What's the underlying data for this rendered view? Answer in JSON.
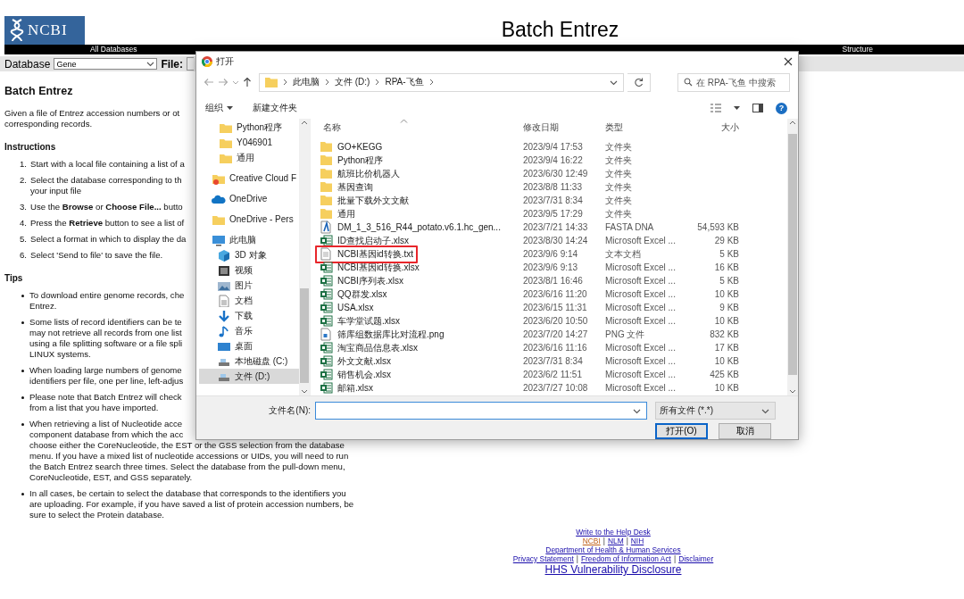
{
  "header": {
    "logo_text": "NCBI",
    "title": "Batch Entrez"
  },
  "nav_bar": [
    "All Databases",
    "Structure"
  ],
  "search_row": {
    "database_label": "Database",
    "database_value": "Gene",
    "file_label": "File:"
  },
  "content": {
    "heading": "Batch Entrez",
    "intro": [
      "Given a file of Entrez accession numbers or ot",
      "corresponding records."
    ],
    "sections": [
      {
        "heading": "Instructions",
        "kind": "numbered",
        "items": [
          {
            "number": "1.",
            "lines": [
              "Start with a local file containing a list of a"
            ]
          },
          {
            "number": "2.",
            "lines": [
              "Select the database corresponding to th",
              "your input file"
            ]
          },
          {
            "number": "3.",
            "lines": [
              "Use the **Browse** or **Choose File...** butto"
            ]
          },
          {
            "number": "4.",
            "lines": [
              "Press the **Retrieve** button to see a list of"
            ]
          },
          {
            "number": "5.",
            "lines": [
              "Select a format in which to display the da"
            ]
          },
          {
            "number": "6.",
            "lines": [
              "Select 'Send to file' to save the file."
            ]
          }
        ]
      },
      {
        "heading": "Tips",
        "kind": "bulleted",
        "items": [
          {
            "lines": [
              "To download entire genome records, che",
              "Entrez."
            ]
          },
          {
            "lines": [
              "Some lists of record identifiers can be te",
              "may not retrieve all records from one list",
              "using a file splitting software or a file spli",
              "LINUX systems."
            ]
          },
          {
            "lines": [
              "When loading large numbers of genome",
              "identifiers per file, one per line, left-adjus"
            ]
          },
          {
            "lines": [
              "Please note that Batch Entrez will check",
              "from a list that you have imported."
            ]
          },
          {
            "lines": [
              "When retrieving a list of Nucleotide acce",
              "component database from which the acc",
              "choose either the CoreNucleotide, the EST or the GSS selection from the database",
              "menu. If you have a mixed list of nucleotide accessions or UIDs, you will need to run",
              "the Batch Entrez search three times. Select the database from the pull-down menu,",
              "CoreNucleotide, EST, and GSS separately."
            ]
          },
          {
            "lines": [
              "In all cases, be certain to select the database that corresponds to the identifiers you",
              "are uploading. For example, if you have saved a list of protein accession numbers, be",
              "sure to select the Protein database."
            ]
          }
        ]
      }
    ]
  },
  "footer": [
    [
      {
        "kind": "link",
        "text": "Write to the Help Desk",
        "visited": false
      }
    ],
    [
      {
        "kind": "link",
        "text": "NCBI",
        "visited": true
      },
      {
        "kind": "separator",
        "text": "|"
      },
      {
        "kind": "link",
        "text": "NLM",
        "visited": false
      },
      {
        "kind": "separator",
        "text": "|"
      },
      {
        "kind": "link",
        "text": "NIH",
        "visited": false
      }
    ],
    [
      {
        "kind": "link",
        "text": "Department of Health & Human Services",
        "visited": false
      }
    ],
    [
      {
        "kind": "link",
        "text": "Privacy Statement",
        "visited": false
      },
      {
        "kind": "separator",
        "text": "|"
      },
      {
        "kind": "link",
        "text": "Freedom of Information Act",
        "visited": false
      },
      {
        "kind": "separator",
        "text": "|"
      },
      {
        "kind": "link",
        "text": "Disclaimer",
        "visited": false
      }
    ],
    [
      {
        "kind": "large-link",
        "text": "HHS Vulnerability Disclosure",
        "visited": false
      }
    ]
  ],
  "dialog": {
    "title": "打开",
    "path": [
      "此电脑",
      "文件 (D:)",
      "RPA-飞鱼"
    ],
    "search": {
      "placeholder": "在 RPA-飞鱼 中搜索"
    },
    "toolbar": [
      {
        "label": "组织",
        "kind": "menu"
      },
      {
        "label": "新建文件夹",
        "kind": "button"
      }
    ],
    "help_label": "?",
    "nav": {
      "scrolled_children": [
        {
          "label": "Python程序",
          "kind": "folder",
          "selected": false
        },
        {
          "label": "Y046901",
          "kind": "folder",
          "selected": false
        },
        {
          "label": "通用",
          "kind": "folder",
          "selected": false
        }
      ],
      "items": [
        {
          "label": "Creative Cloud F",
          "kind": "cloud-folder",
          "selected": false
        },
        {
          "label": "OneDrive",
          "kind": "cloud",
          "selected": false
        },
        {
          "label": "OneDrive - Pers",
          "kind": "folder",
          "selected": false
        },
        {
          "label": "此电脑",
          "kind": "computer",
          "selected": false,
          "children": [
            {
              "label": "3D 对象",
              "kind": "cube",
              "selected": false
            },
            {
              "label": "视频",
              "kind": "video",
              "selected": false
            },
            {
              "label": "图片",
              "kind": "image",
              "selected": false
            },
            {
              "label": "文档",
              "kind": "document",
              "selected": false
            },
            {
              "label": "下载",
              "kind": "download",
              "selected": false
            },
            {
              "label": "音乐",
              "kind": "music",
              "selected": false
            },
            {
              "label": "桌面",
              "kind": "desktop",
              "selected": false
            },
            {
              "label": "本地磁盘 (C:)",
              "kind": "drive",
              "selected": false
            },
            {
              "label": "文件 (D:)",
              "kind": "drive",
              "selected": true
            }
          ]
        }
      ]
    },
    "columns": [
      "名称",
      "修改日期",
      "类型",
      "大小"
    ],
    "rows": [
      {
        "name": "GO+KEGG",
        "date": "2023/9/4 17:53",
        "type": "文件夹",
        "kind": "folder",
        "highlighted": false
      },
      {
        "name": "Python程序",
        "date": "2023/9/4 16:22",
        "type": "文件夹",
        "kind": "folder",
        "highlighted": false
      },
      {
        "name": "航班比价机器人",
        "date": "2023/6/30 12:49",
        "type": "文件夹",
        "kind": "folder",
        "highlighted": false
      },
      {
        "name": "基因查询",
        "date": "2023/8/8 11:33",
        "type": "文件夹",
        "kind": "folder",
        "highlighted": false
      },
      {
        "name": "批量下载外文文献",
        "date": "2023/7/31 8:34",
        "type": "文件夹",
        "kind": "folder",
        "highlighted": false
      },
      {
        "name": "通用",
        "date": "2023/9/5 17:29",
        "type": "文件夹",
        "kind": "folder",
        "highlighted": false
      },
      {
        "name": "DM_1_3_516_R44_potato.v6.1.hc_gen...",
        "date": "2023/7/21 14:33",
        "type": "FASTA DNA",
        "size": "54,593 KB",
        "kind": "fasta",
        "highlighted": false
      },
      {
        "name": "ID查找启动子.xlsx",
        "date": "2023/8/30 14:24",
        "type": "Microsoft Excel ...",
        "size": "29 KB",
        "kind": "excel",
        "highlighted": false
      },
      {
        "name": "NCBI基因id转换.txt",
        "date": "2023/9/6 9:14",
        "type": "文本文档",
        "size": "5 KB",
        "kind": "text",
        "highlighted": true
      },
      {
        "name": "NCBI基因id转换.xlsx",
        "date": "2023/9/6 9:13",
        "type": "Microsoft Excel ...",
        "size": "16 KB",
        "kind": "excel",
        "highlighted": false
      },
      {
        "name": "NCBI序列表.xlsx",
        "date": "2023/8/1 16:46",
        "type": "Microsoft Excel ...",
        "size": "5 KB",
        "kind": "excel",
        "highlighted": false
      },
      {
        "name": "QQ群发.xlsx",
        "date": "2023/6/16 11:20",
        "type": "Microsoft Excel ...",
        "size": "10 KB",
        "kind": "excel",
        "highlighted": false
      },
      {
        "name": "USA.xlsx",
        "date": "2023/6/15 11:31",
        "type": "Microsoft Excel ...",
        "size": "9 KB",
        "kind": "excel",
        "highlighted": false
      },
      {
        "name": "车学堂试题.xlsx",
        "date": "2023/6/20 10:50",
        "type": "Microsoft Excel ...",
        "size": "10 KB",
        "kind": "excel",
        "highlighted": false
      },
      {
        "name": "筛库组数据库比对流程.png",
        "date": "2023/7/20 14:27",
        "type": "PNG 文件",
        "size": "832 KB",
        "kind": "image",
        "highlighted": false
      },
      {
        "name": "淘宝商品信息表.xlsx",
        "date": "2023/6/16 11:16",
        "type": "Microsoft Excel ...",
        "size": "17 KB",
        "kind": "excel",
        "highlighted": false
      },
      {
        "name": "外文文献.xlsx",
        "date": "2023/7/31 8:34",
        "type": "Microsoft Excel ...",
        "size": "10 KB",
        "kind": "excel",
        "highlighted": false
      },
      {
        "name": "销售机会.xlsx",
        "date": "2023/6/2 11:51",
        "type": "Microsoft Excel ...",
        "size": "425 KB",
        "kind": "excel",
        "highlighted": false
      },
      {
        "name": "邮箱.xlsx",
        "date": "2023/7/27 10:08",
        "type": "Microsoft Excel ...",
        "size": "10 KB",
        "kind": "excel",
        "highlighted": false
      }
    ],
    "filename_label": "文件名(N):",
    "filetype": "所有文件 (*.*)",
    "buttons": [
      {
        "label": "打开(O)",
        "default": true
      },
      {
        "label": "取消",
        "default": false
      }
    ]
  }
}
